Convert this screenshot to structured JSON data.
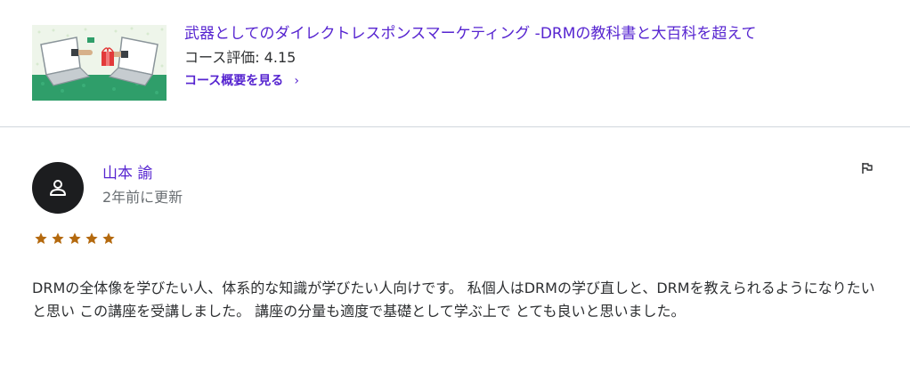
{
  "course": {
    "title": "武器としてのダイレクトレスポンスマーケティング -DRMの教科書と大百科を超えて",
    "rating_text": "コース評価: 4.15",
    "link_label": "コース概要を見る",
    "link_chevron": "›",
    "thumbnail_icon": "laptops-exchanging-gift-illustration"
  },
  "review": {
    "reviewer_name": "山本 諭",
    "date": "2年前に更新",
    "avatar_icon": "person-icon",
    "flag_icon": "flag-icon",
    "stars": 5,
    "star_color": "#b4690e",
    "text": "DRMの全体像を学びたい人、体系的な知識が学びたい人向けです。 私個人はDRMの学び直しと、DRMを教えられるようになりたいと思い この講座を受講しました。 講座の分量も適度で基礎として学ぶ上で とても良いと思いました。"
  },
  "colors": {
    "link_purple": "#5624d0",
    "text_dark": "#2d2f31",
    "text_muted": "#6a6f73",
    "divider": "#d1d7dc",
    "avatar_bg": "#1c1d1f"
  }
}
